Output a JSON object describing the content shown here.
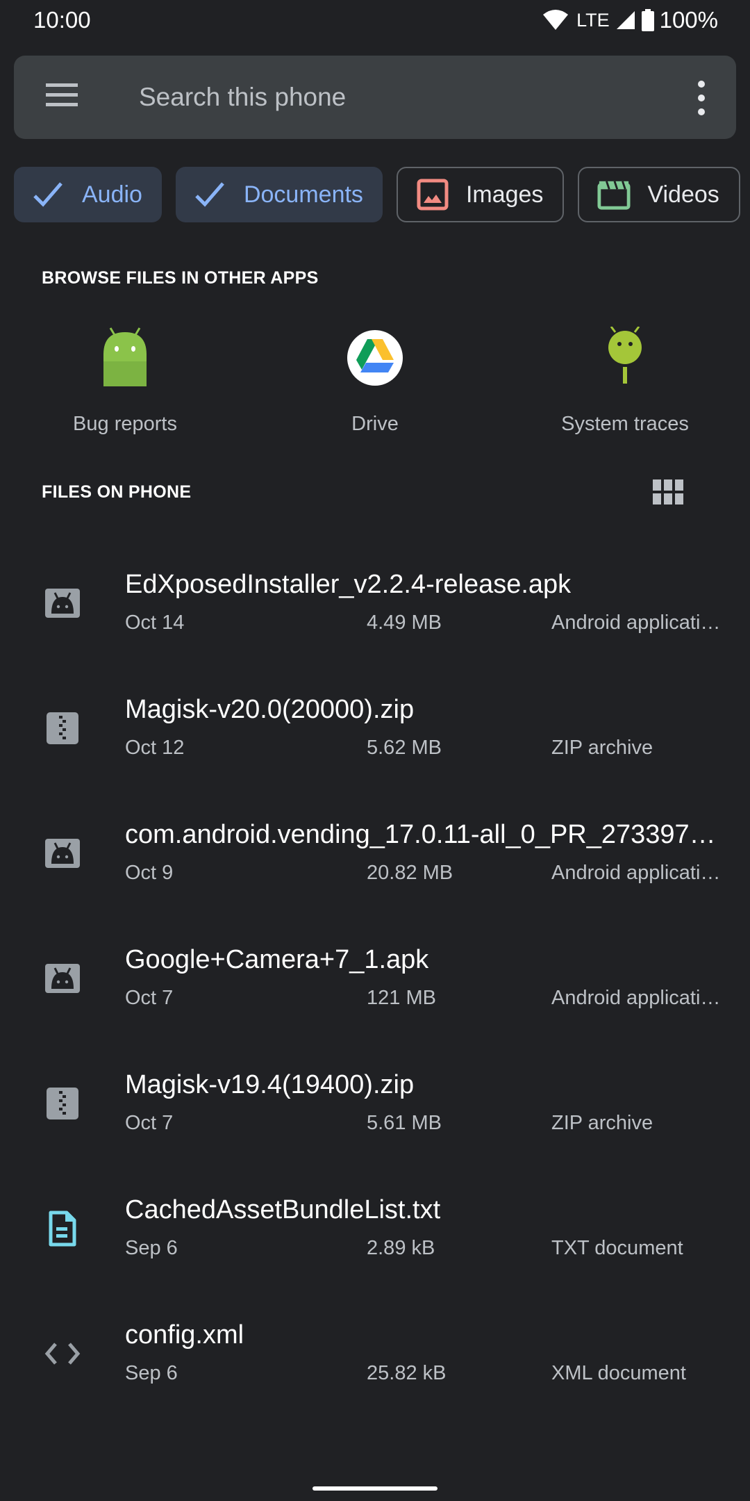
{
  "status_bar": {
    "time": "10:00",
    "network": "LTE",
    "battery": "100%",
    "icons": [
      "wifi-icon",
      "signal-icon",
      "battery-icon"
    ]
  },
  "search": {
    "placeholder": "Search this phone",
    "value": "",
    "menu_icon": "hamburger-menu-icon",
    "more_icon": "more-vert-icon"
  },
  "chips": [
    {
      "label": "Audio",
      "selected": true,
      "icon": "check-icon"
    },
    {
      "label": "Documents",
      "selected": true,
      "icon": "check-icon"
    },
    {
      "label": "Images",
      "selected": false,
      "icon": "image-icon",
      "color": "#f28b82"
    },
    {
      "label": "Videos",
      "selected": false,
      "icon": "clapperboard-icon",
      "color": "#81c995"
    }
  ],
  "browse_section": {
    "title": "BROWSE FILES IN OTHER APPS",
    "apps": [
      {
        "label": "Bug reports",
        "icon": "android-bug-icon"
      },
      {
        "label": "Drive",
        "icon": "google-drive-icon"
      },
      {
        "label": "System traces",
        "icon": "system-traces-icon"
      }
    ]
  },
  "files_section": {
    "title": "FILES ON PHONE",
    "view_toggle_icon": "grid-view-icon",
    "files": [
      {
        "name": "EdXposedInstaller_v2.2.4-release.apk",
        "date": "Oct 14",
        "size": "4.49 MB",
        "type": "Android applicati…",
        "icon": "android-app-icon"
      },
      {
        "name": "Magisk-v20.0(20000).zip",
        "date": "Oct 12",
        "size": "5.62 MB",
        "type": "ZIP archive",
        "icon": "zip-icon"
      },
      {
        "name": "com.android.vending_17.0.11-all_0_PR_273397…",
        "date": "Oct 9",
        "size": "20.82 MB",
        "type": "Android applicati…",
        "icon": "android-app-icon"
      },
      {
        "name": "Google+Camera+7_1.apk",
        "date": "Oct 7",
        "size": "121 MB",
        "type": "Android applicati…",
        "icon": "android-app-icon"
      },
      {
        "name": "Magisk-v19.4(19400).zip",
        "date": "Oct 7",
        "size": "5.61 MB",
        "type": "ZIP archive",
        "icon": "zip-icon"
      },
      {
        "name": "CachedAssetBundleList.txt",
        "date": "Sep 6",
        "size": "2.89 kB",
        "type": "TXT document",
        "icon": "text-document-icon"
      },
      {
        "name": "config.xml",
        "date": "Sep 6",
        "size": "25.82 kB",
        "type": "XML document",
        "icon": "code-icon"
      }
    ]
  },
  "colors": {
    "background": "#202124",
    "search_bg": "#3c4043",
    "chip_selected_bg": "#323a48",
    "accent_blue": "#8ab4f8",
    "images_red": "#f28b82",
    "videos_green": "#81c995",
    "txt_cyan": "#78d9ec",
    "android_green": "#8bc34a",
    "traces_lime": "#a4c639"
  }
}
